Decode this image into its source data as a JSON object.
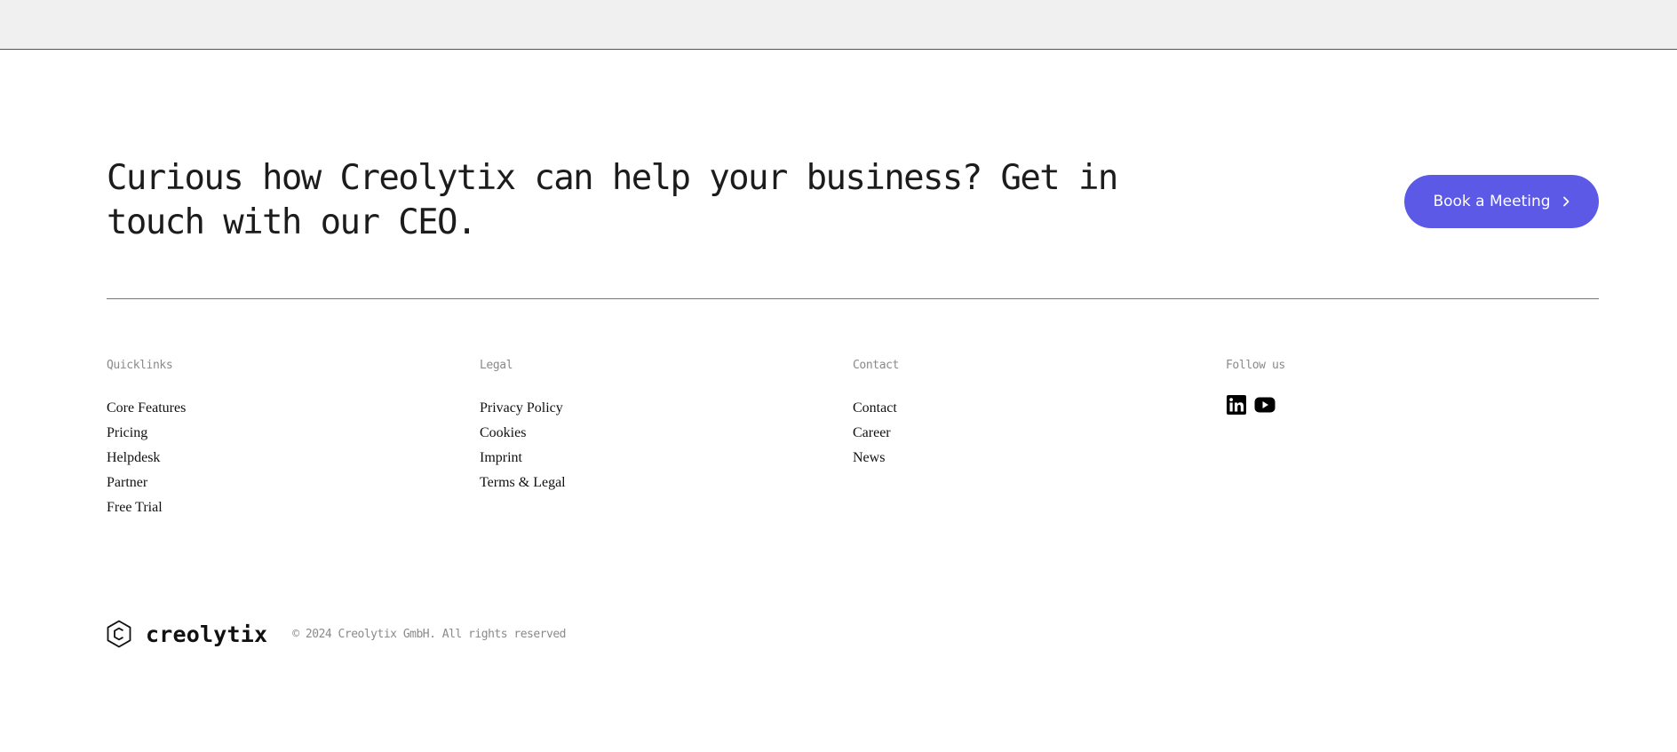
{
  "cta": {
    "heading": "Curious how Creolytix can help your business? Get in touch with our CEO.",
    "button_label": "Book a Meeting",
    "button_icon": "chevron-right-icon",
    "accent_color": "#5b59e6"
  },
  "footer": {
    "quicklinks": {
      "title": "Quicklinks",
      "items": [
        "Core Features",
        "Pricing",
        "Helpdesk",
        "Partner",
        "Free Trial"
      ]
    },
    "legal": {
      "title": "Legal",
      "items": [
        "Privacy Policy",
        "Cookies",
        "Imprint",
        "Terms & Legal"
      ]
    },
    "contact": {
      "title": "Contact",
      "items": [
        "Contact",
        "Career",
        "News"
      ]
    },
    "follow": {
      "title": "Follow us",
      "icons": [
        "linkedin-icon",
        "youtube-icon"
      ]
    }
  },
  "bottom": {
    "logo_text": "creolytix",
    "logo_icon": "hexagon-c-logo-icon",
    "copyright": "© 2024 Creolytix GmbH. All rights reserved"
  }
}
